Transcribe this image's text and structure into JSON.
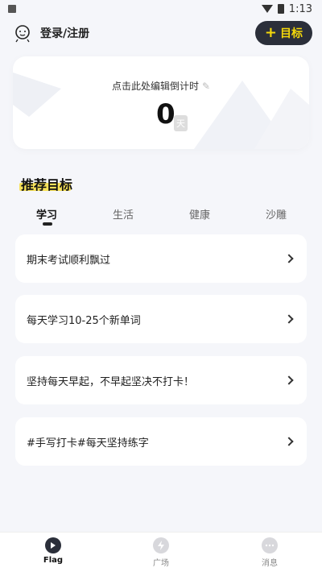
{
  "status_bar": {
    "time": "1:13"
  },
  "header": {
    "login_label": "登录/注册",
    "goal_button_label": "目标"
  },
  "countdown": {
    "hint": "点击此处编辑倒计时",
    "value": "0",
    "unit": "天"
  },
  "recommend": {
    "title": "推荐目标",
    "tabs": [
      {
        "label": "学习",
        "active": true
      },
      {
        "label": "生活",
        "active": false
      },
      {
        "label": "健康",
        "active": false
      },
      {
        "label": "沙雕",
        "active": false
      }
    ],
    "goals": [
      {
        "text": "期末考试顺利飘过"
      },
      {
        "text": "每天学习10-25个新单词"
      },
      {
        "text": "坚持每天早起，不早起坚决不打卡！"
      },
      {
        "text": "#手写打卡#每天坚持练字"
      }
    ]
  },
  "bottom_nav": {
    "items": [
      {
        "label": "Flag",
        "icon": "flag-icon",
        "active": true
      },
      {
        "label": "广场",
        "icon": "lightning-icon",
        "active": false
      },
      {
        "label": "消息",
        "icon": "chat-icon",
        "active": false
      }
    ]
  },
  "colors": {
    "accent_yellow": "#f5d90a",
    "dark_button": "#2b2f3a",
    "highlight": "#f8e35a"
  }
}
